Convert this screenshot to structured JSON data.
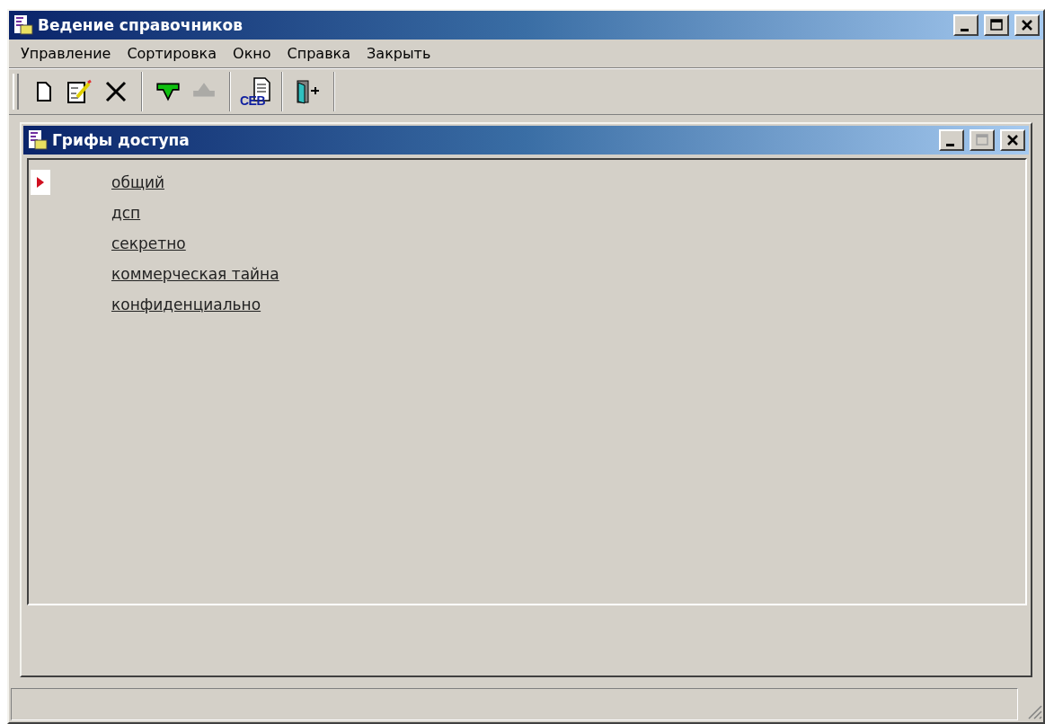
{
  "window": {
    "title": "Ведение справочников",
    "buttons": [
      {
        "kind": "minimize",
        "disabled": false
      },
      {
        "kind": "maximize",
        "disabled": false
      },
      {
        "kind": "close",
        "disabled": false
      }
    ]
  },
  "menu": [
    "Управление",
    "Сортировка",
    "Окно",
    "Справка",
    "Закрыть"
  ],
  "toolbar": [
    {
      "kind": "new",
      "disabled": false
    },
    {
      "kind": "edit",
      "disabled": false
    },
    {
      "kind": "delete",
      "disabled": false
    },
    {
      "kind": "separator"
    },
    {
      "kind": "down",
      "disabled": false
    },
    {
      "kind": "up",
      "disabled": true
    },
    {
      "kind": "separator"
    },
    {
      "kind": "report",
      "label": "CEB",
      "disabled": false
    },
    {
      "kind": "separator"
    },
    {
      "kind": "exit",
      "disabled": false
    },
    {
      "kind": "separator"
    }
  ],
  "child_window": {
    "title": "Грифы доступа",
    "buttons": [
      {
        "kind": "minimize",
        "disabled": false
      },
      {
        "kind": "maximize",
        "disabled": true
      },
      {
        "kind": "close",
        "disabled": false
      }
    ]
  },
  "items": [
    {
      "label": "общий",
      "selected": true
    },
    {
      "label": "дсп",
      "selected": false
    },
    {
      "label": "секретно",
      "selected": false
    },
    {
      "label": "коммерческая тайна",
      "selected": false
    },
    {
      "label": "конфиденциально",
      "selected": false
    }
  ]
}
